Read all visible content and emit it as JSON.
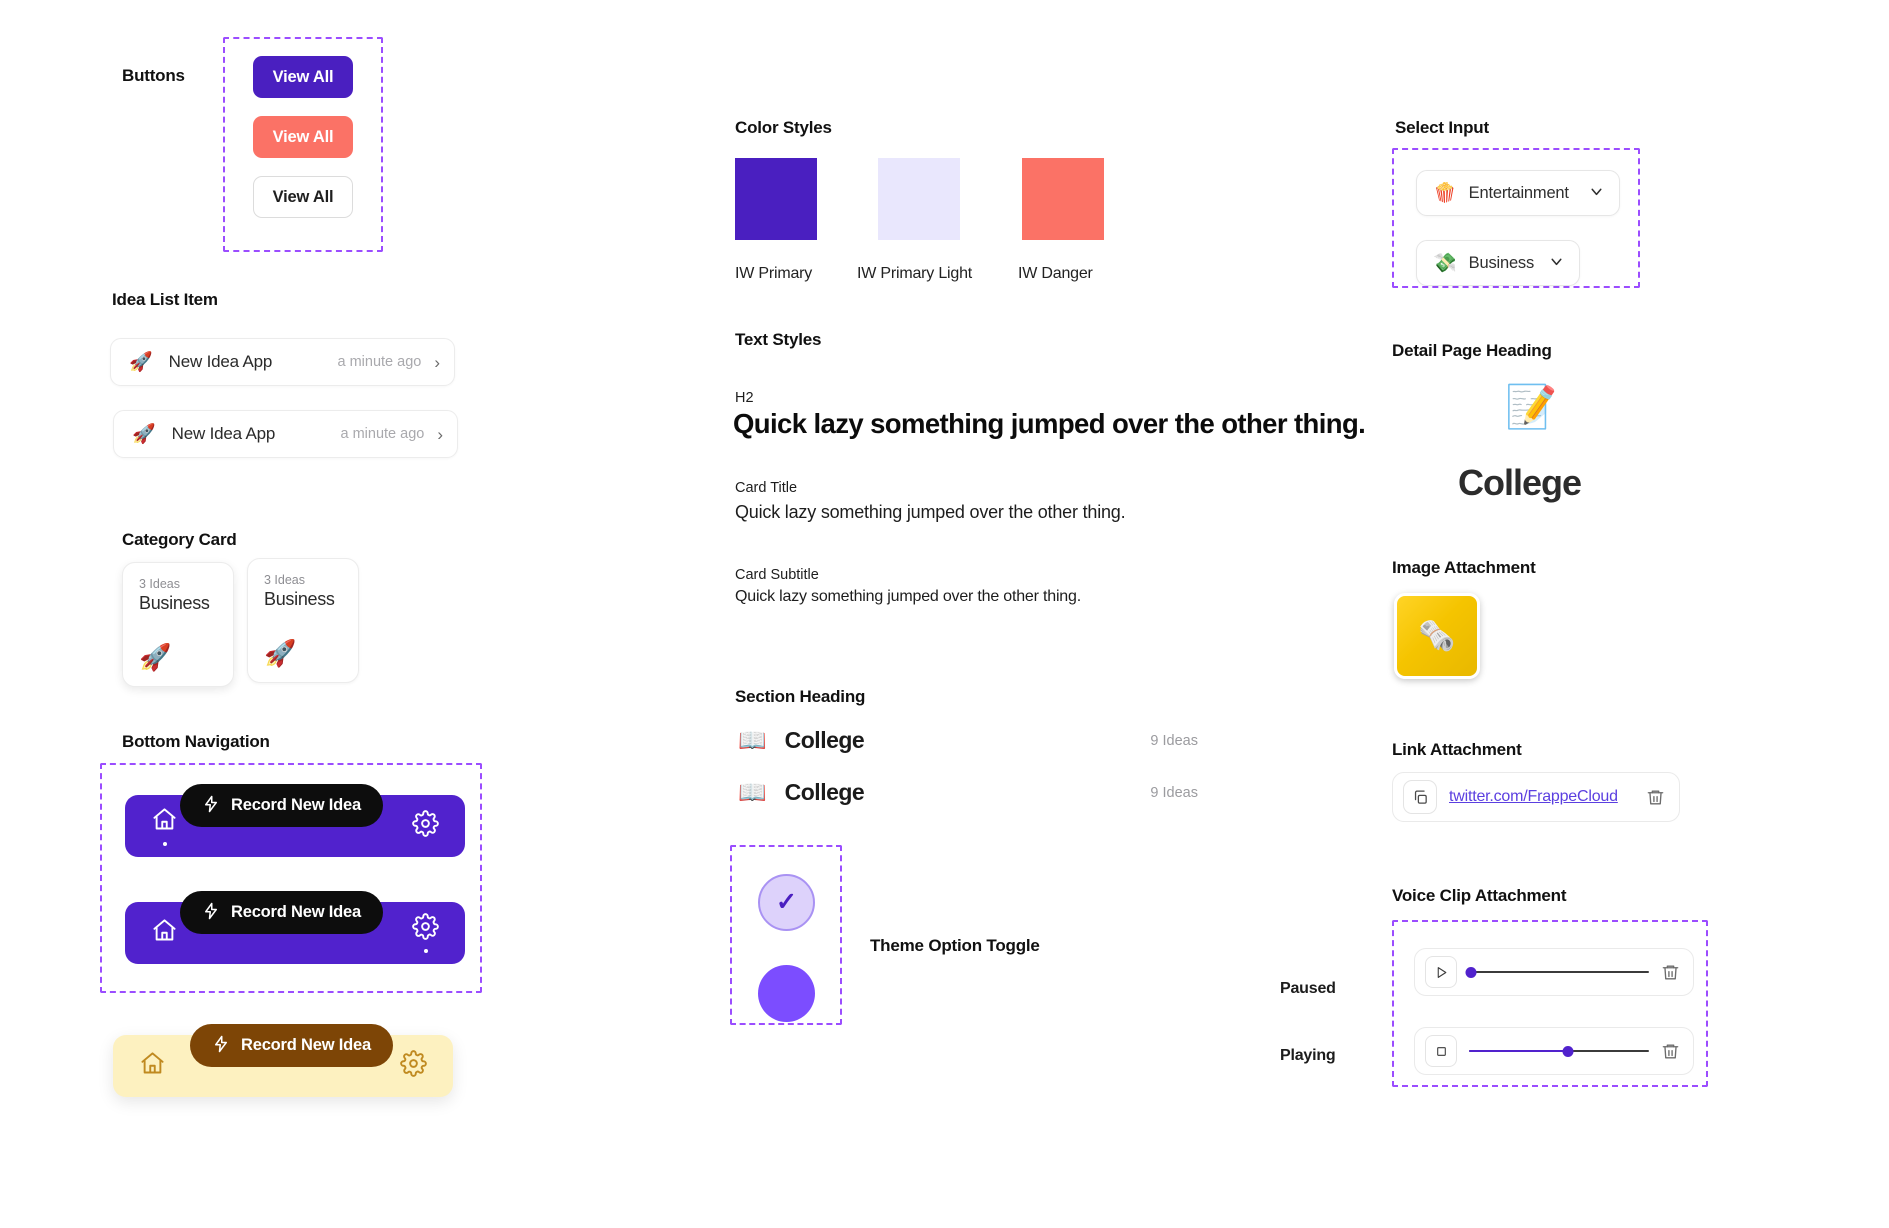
{
  "colors": {
    "iw_primary": "#4a1fc0",
    "iw_primary_light": "#e9e7fd",
    "iw_danger": "#fb7266",
    "nav_purple": "#5122cd",
    "nav_yellow": "#fdf1c0",
    "record_brown": "#7d4506",
    "link_purple": "#5b3fe0",
    "dashed_guide": "#9b4dff"
  },
  "buttons": {
    "section_label": "Buttons",
    "items": [
      {
        "label": "View All",
        "variant": "primary"
      },
      {
        "label": "View All",
        "variant": "danger"
      },
      {
        "label": "View All",
        "variant": "outline"
      }
    ]
  },
  "idea_list": {
    "section_label": "Idea List Item",
    "items": [
      {
        "emoji": "🚀",
        "title": "New Idea App",
        "time": "a minute ago",
        "chevron": "›"
      },
      {
        "emoji": "🚀",
        "title": "New Idea App",
        "time": "a minute ago",
        "chevron": "›"
      }
    ]
  },
  "category_card": {
    "section_label": "Category Card",
    "items": [
      {
        "count": "3 Ideas",
        "name": "Business",
        "emoji": "🚀"
      },
      {
        "count": "3 Ideas",
        "name": "Business",
        "emoji": "🚀"
      }
    ]
  },
  "bottom_navigation": {
    "section_label": "Bottom Navigation",
    "bars": [
      {
        "home_icon": "home-icon",
        "settings_icon": "gear-icon",
        "record_label": "Record New Idea",
        "bolt": "⚡",
        "active": "home"
      },
      {
        "home_icon": "home-icon",
        "settings_icon": "gear-icon",
        "record_label": "Record New Idea",
        "bolt": "⚡",
        "active": "settings"
      }
    ],
    "yellow_bar": {
      "home_icon": "home-icon",
      "settings_icon": "gear-icon",
      "record_label": "Record New Idea",
      "bolt": "⚡"
    }
  },
  "color_styles": {
    "section_label": "Color Styles",
    "swatches": [
      {
        "name": "IW Primary",
        "hex": "#4a1fc0"
      },
      {
        "name": "IW Primary Light",
        "hex": "#e9e7fd"
      },
      {
        "name": "IW Danger",
        "hex": "#fb7266"
      }
    ]
  },
  "text_styles": {
    "section_label": "Text Styles",
    "samples": [
      {
        "tag": "H2",
        "text": "Quick lazy something jumped over the other thing."
      },
      {
        "tag": "Card Title",
        "text": "Quick lazy something jumped over the other thing."
      },
      {
        "tag": "Card Subtitle",
        "text": "Quick lazy something jumped over the other thing."
      }
    ]
  },
  "section_heading": {
    "section_label": "Section Heading",
    "rows": [
      {
        "emoji": "📖",
        "title": "College",
        "count": "9 Ideas"
      },
      {
        "emoji": "📖",
        "title": "College",
        "count": "9 Ideas"
      }
    ]
  },
  "theme_toggle": {
    "label": "Theme Option Toggle",
    "options": [
      {
        "state": "selected",
        "check": "✓",
        "fill": "#ddd2fb",
        "ring": "#a992f3"
      },
      {
        "state": "unselected",
        "fill": "#7c4dff"
      }
    ]
  },
  "select_input": {
    "section_label": "Select Input",
    "items": [
      {
        "emoji": "🍿",
        "value": "Entertainment",
        "chevron": "⌄"
      },
      {
        "emoji": "💸",
        "value": "Business",
        "chevron": "⌄"
      }
    ]
  },
  "detail_page_heading": {
    "section_label": "Detail Page Heading",
    "emoji": "📝",
    "title": "College"
  },
  "image_attachment": {
    "section_label": "Image Attachment",
    "thumb_emoji": "🗞️"
  },
  "link_attachment": {
    "section_label": "Link Attachment",
    "copy_icon": "copy-icon",
    "url": "twitter.com/FrappeCloud",
    "delete_icon": "trash-icon"
  },
  "voice_clip_attachment": {
    "section_label": "Voice Clip Attachment",
    "players": [
      {
        "state_label": "Paused",
        "button_icon": "play-icon",
        "progress_percent": 1,
        "delete_icon": "trash-icon"
      },
      {
        "state_label": "Playing",
        "button_icon": "stop-icon",
        "progress_percent": 55,
        "delete_icon": "trash-icon"
      }
    ]
  }
}
